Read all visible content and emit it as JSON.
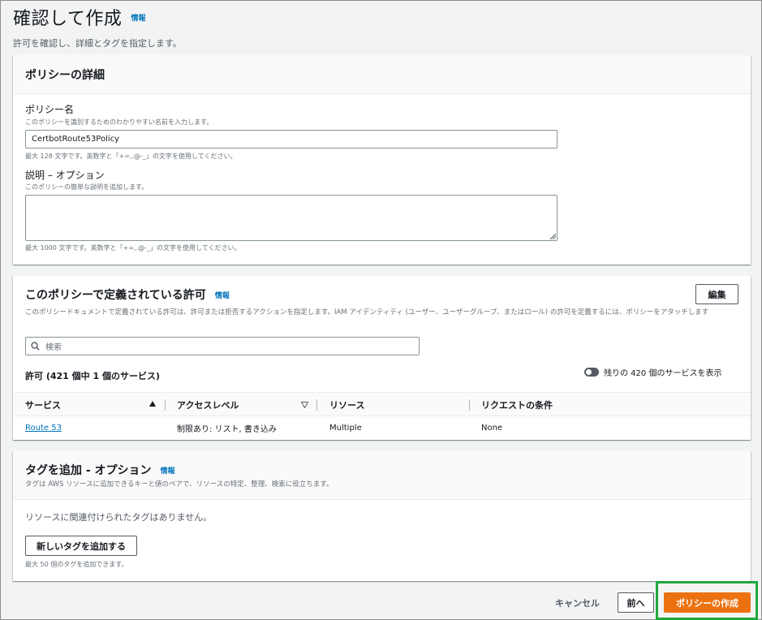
{
  "page": {
    "title": "確認して作成",
    "info_label": "情報",
    "subtitle": "許可を確認し、詳細とタグを指定します。"
  },
  "details": {
    "title": "ポリシーの詳細",
    "name_label": "ポリシー名",
    "name_desc": "このポリシーを識別するためのわかりやすい名前を入力します。",
    "name_value": "CertbotRoute53Policy",
    "name_hint": "最大 128 文字です。英数字と「+=,.@-_」の文字を使用してください。",
    "desc_label": "説明 – オプション",
    "desc_desc": "このポリシーの簡単な説明を追加します。",
    "desc_value": "",
    "desc_hint": "最大 1000 文字です。英数字と「+=,.@-_」の文字を使用してください。"
  },
  "permissions": {
    "title": "このポリシーで定義されている許可",
    "info_label": "情報",
    "edit_label": "編集",
    "description": "このポリシードキュメントで定義されている許可は、許可または拒否するアクションを指定します。IAM アイデンティティ (ユーザー、ユーザーグループ、またはロール) の許可を定義するには、ポリシーをアタッチします",
    "search_placeholder": "検索",
    "count_label": "許可 (421 個中 1 個のサービス)",
    "toggle_label": "残りの 420 個のサービスを表示",
    "toggle_on": false,
    "columns": [
      "サービス",
      "アクセスレベル",
      "リソース",
      "リクエストの条件"
    ],
    "rows": [
      {
        "service": "Route 53",
        "access": "制限あり: リスト, 書き込み",
        "resource": "Multiple",
        "condition": "None"
      }
    ]
  },
  "tags": {
    "title": "タグを追加 - オプション",
    "info_label": "情報",
    "description": "タグは AWS リソースに追加できるキーと値のペアで、リソースの特定、整理、検索に役立ちます。",
    "empty_text": "リソースに関連付けられたタグはありません。",
    "add_button": "新しいタグを追加する",
    "hint": "最大 50 個のタグを追加できます。"
  },
  "footer": {
    "cancel": "キャンセル",
    "previous": "前へ",
    "create": "ポリシーの作成"
  },
  "colors": {
    "primary": "#ec7211",
    "link": "#0073bb",
    "highlight": "#1fa83d"
  }
}
